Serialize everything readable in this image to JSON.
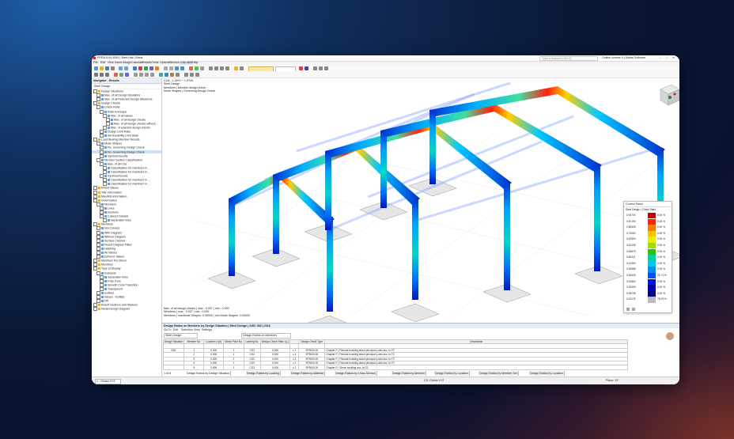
{
  "window": {
    "title": "RFEM 6.04.0009 | Steel Hall | Blank",
    "menu": [
      "File",
      "Edit",
      "View",
      "Insert",
      "Assign",
      "Calculate",
      "Results",
      "Tools",
      "Options",
      "Window",
      "CAD-BIM",
      "Help"
    ],
    "search_placeholder": "Type a keyword (Alt+Q)",
    "license": "Online License 4 | Dlubal Software"
  },
  "navigator": {
    "title": "Navigator - Results",
    "subtitle": "Steel Design",
    "items": [
      {
        "label": "Design Situations",
        "level": 0
      },
      {
        "label": "Max. of all Design Situations",
        "level": 1
      },
      {
        "label": "Max. of all Relevant Design Situations",
        "level": 1
      },
      {
        "label": "Design Checks",
        "level": 0
      },
      {
        "label": "Check Ratio",
        "level": 1
      },
      {
        "label": "Ratio Envelope",
        "level": 2
      },
      {
        "label": "Max. of all values",
        "level": 3
      },
      {
        "label": "Max. of all design checks",
        "level": 4
      },
      {
        "label": "Max. of all design checks without...",
        "level": 4
      },
      {
        "label": "Max. of selected design checks",
        "level": 3
      },
      {
        "label": "Design Limit Ratio",
        "level": 2
      },
      {
        "label": "Serviceability Limit State",
        "level": 2
      },
      {
        "label": "Load Bearing Member Results",
        "level": 0
      },
      {
        "label": "Mode Shapes",
        "level": 1
      },
      {
        "label": "No. Governing Design Check",
        "level": 2
      },
      {
        "label": "No. Governing Design Check",
        "level": 2
      },
      {
        "label": "Symbols/results",
        "level": 2
      },
      {
        "label": "Member Section Classification",
        "level": 1
      },
      {
        "label": "Max. of all CSs",
        "level": 2
      },
      {
        "label": "Classification for members in ...",
        "level": 3
      },
      {
        "label": "Classification for members in ...",
        "level": 3
      },
      {
        "label": "Symbols/results",
        "level": 2
      },
      {
        "label": "Classification for members in ...",
        "level": 3
      },
      {
        "label": "Classification for members in ...",
        "level": 3
      },
      {
        "label": "Result Values",
        "level": 0
      },
      {
        "label": "Title Information",
        "level": 0
      },
      {
        "label": "Max/Min information",
        "level": 0
      },
      {
        "label": "Deformation",
        "level": 0
      },
      {
        "label": "Members",
        "level": 1
      },
      {
        "label": "Lines",
        "level": 2
      },
      {
        "label": "Sections",
        "level": 2
      },
      {
        "label": "Colored Colored",
        "level": 2
      },
      {
        "label": "Separation lines",
        "level": 3
      },
      {
        "label": "Members",
        "level": 0
      },
      {
        "label": "Not Colored",
        "level": 1
      },
      {
        "label": "With Diagram",
        "level": 1
      },
      {
        "label": "Without Diagram",
        "level": 1
      },
      {
        "label": "Surface Colored",
        "level": 1
      },
      {
        "label": "Result Diagram Filled",
        "level": 1
      },
      {
        "label": "Hatching",
        "level": 1
      },
      {
        "label": "All Values",
        "level": 1
      },
      {
        "label": "Extreme Values",
        "level": 1
      },
      {
        "label": "Members Ra Check",
        "level": 0
      },
      {
        "label": "Members",
        "level": 0
      },
      {
        "label": "Type of Display",
        "level": 0
      },
      {
        "label": "Isobands",
        "level": 1
      },
      {
        "label": "Separation lines",
        "level": 2
      },
      {
        "label": "Gray Zone",
        "level": 2
      },
      {
        "label": "Smooth Color Transition",
        "level": 2
      },
      {
        "label": "Transparent",
        "level": 2
      },
      {
        "label": "Isolines",
        "level": 1
      },
      {
        "label": "Values - Isoflats",
        "level": 1
      },
      {
        "label": "Off",
        "level": 1
      },
      {
        "label": "Result Sections and Markers",
        "level": 0
      },
      {
        "label": "Nodal Design Diagram",
        "level": 0
      }
    ],
    "selected_index": 15
  },
  "viewport": {
    "header_lines": [
      "CO4 - 1.35*G + 1.5*W1",
      "Steel Design",
      "Members | Member design check ◦",
      "Mode Shapes | Governing Design Check"
    ],
    "footer_lines": [
      "Max. of all design checks | max : 0.937 | min : 0.000",
      "Members | max : 0.937 | min : 0.000",
      "Members | maxMode Shapes: 0.00000 | min Mode Shapes: 0.00000"
    ]
  },
  "legend": {
    "title": "Control Panel",
    "subtitle": "Steel Design | Check Ratio",
    "rows": [
      {
        "v": "0.93730",
        "c": "#cc0000",
        "p": "0.00 %"
      },
      {
        "v": "0.87190",
        "c": "#ff2200",
        "p": "0.00 %"
      },
      {
        "v": "0.80625",
        "c": "#ff7a00",
        "p": "0.00 %"
      },
      {
        "v": "0.74063",
        "c": "#ffc000",
        "p": "0.00 %"
      },
      {
        "v": "0.67500",
        "c": "#e8f000",
        "p": "0.00 %"
      },
      {
        "v": "0.61238",
        "c": "#9ce000",
        "p": "0.00 %"
      },
      {
        "v": "0.54675",
        "c": "#28c800",
        "p": "0.00 %"
      },
      {
        "v": "0.48113",
        "c": "#00d2a0",
        "p": "0.00 %"
      },
      {
        "v": "0.41550",
        "c": "#00c8e6",
        "p": "0.00 %"
      },
      {
        "v": "0.34988",
        "c": "#008cff",
        "p": "0.00 %"
      },
      {
        "v": "0.28425",
        "c": "#0050ff",
        "p": "21.71 %"
      },
      {
        "v": "0.21863",
        "c": "#0014e6",
        "p": "0.00 %"
      },
      {
        "v": "0.15300",
        "c": "#0000b4",
        "p": "0.00 %"
      },
      {
        "v": "0.08738",
        "c": "#000082",
        "p": "0.00 %"
      },
      {
        "v": "0.02175",
        "c": "#bbbbbb",
        "p": "78.29 %"
      }
    ]
  },
  "results_panel": {
    "title": "Design Ratios on Members by Design Situation | Steel Design | AISC 360 | 2016",
    "menu": [
      "Go To",
      "Edit",
      "Selection",
      "View",
      "Settings"
    ],
    "dropdown_left": "Steel Design",
    "dropdown_mid": "Design Ratios on Members",
    "headers": [
      "Design Situation",
      "Member No.",
      "Location x [m]",
      "Shear Point No.",
      "Loading No.",
      "Design Check Ratio η [-]",
      "",
      "Design Check Type",
      "Description"
    ],
    "rows": [
      [
        "",
        "",
        "",
        "",
        "",
        "",
        "",
        "",
        ""
      ],
      [
        "DS1",
        "1",
        "0.000",
        "1",
        "CO2",
        "0.000",
        "≤ 1",
        "SP3000.00",
        "Chapter F | Flexural buckling about principal y-axis acc. to F2"
      ],
      [
        "",
        "2",
        "0.000",
        "1",
        "CO2",
        "0.000",
        "≤ 1",
        "SP3000.00",
        "Chapter F | Flexural buckling about principal y-axis acc. to F2"
      ],
      [
        "",
        "3",
        "0.000",
        "1",
        "CO2",
        "0.000",
        "≤ 1",
        "SP3000.00",
        "Chapter F | Flexural buckling about principal y-axis acc. to F2"
      ],
      [
        "",
        "4",
        "0.000",
        "1",
        "CO2",
        "0.000",
        "≤ 1",
        "SP3000.00",
        "Chapter F | Flexural buckling about principal y-axis acc. to F2"
      ],
      [
        "",
        "5",
        "0.000",
        "1",
        "CO2",
        "0.000",
        "≤ 1",
        "SP3000.00",
        "Chapter E | Shear buckling acc. to G1"
      ]
    ],
    "pager": "1 of 8",
    "tabs": [
      "Design Ratios by Design Situation",
      "Design Ratios by Loading",
      "Design Ratios by Material",
      "Design Ratios by Cross-Section",
      "Design Ratios by Member",
      "Design Ratios by Location",
      "Design Ratios by Member Set",
      "Design Ratios by Location"
    ]
  },
  "statusbar": {
    "left": "1 - Global XYZ",
    "cs": "CS: Global XYZ",
    "plane": "Plane: XY"
  }
}
